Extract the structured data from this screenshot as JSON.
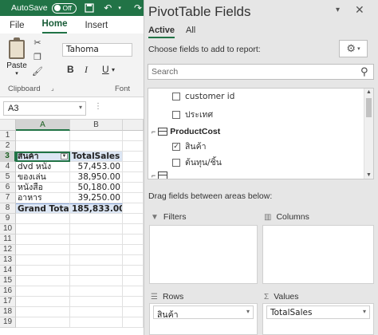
{
  "titlebar": {
    "autosave_label": "AutoSave",
    "autosave_state": "Off"
  },
  "ribbon": {
    "tabs": [
      "File",
      "Home",
      "Insert"
    ],
    "paste_label": "Paste",
    "font_name": "Tahoma",
    "bold": "B",
    "italic": "I",
    "underline": "U",
    "group_clipboard": "Clipboard",
    "group_font": "Font"
  },
  "formula": {
    "name_box": "A3"
  },
  "grid": {
    "columns": [
      "A",
      "B"
    ],
    "rows": [
      {
        "n": "1",
        "a": "",
        "b": ""
      },
      {
        "n": "2",
        "a": "",
        "b": ""
      },
      {
        "n": "3",
        "a": "สินค้า",
        "b": "TotalSales"
      },
      {
        "n": "4",
        "a": "dvd หนัง",
        "b": "57,453.00"
      },
      {
        "n": "5",
        "a": "ของเล่น",
        "b": "38,950.00"
      },
      {
        "n": "6",
        "a": "หนังสือ",
        "b": "50,180.00"
      },
      {
        "n": "7",
        "a": "อาหาร",
        "b": "39,250.00"
      },
      {
        "n": "8",
        "a": "Grand Total",
        "b": "185,833.00"
      },
      {
        "n": "9",
        "a": "",
        "b": ""
      },
      {
        "n": "10",
        "a": "",
        "b": ""
      },
      {
        "n": "11",
        "a": "",
        "b": ""
      },
      {
        "n": "12",
        "a": "",
        "b": ""
      },
      {
        "n": "13",
        "a": "",
        "b": ""
      },
      {
        "n": "14",
        "a": "",
        "b": ""
      },
      {
        "n": "15",
        "a": "",
        "b": ""
      },
      {
        "n": "16",
        "a": "",
        "b": ""
      },
      {
        "n": "17",
        "a": "",
        "b": ""
      },
      {
        "n": "18",
        "a": "",
        "b": ""
      },
      {
        "n": "19",
        "a": "",
        "b": ""
      }
    ]
  },
  "pane": {
    "title": "PivotTable Fields",
    "tabs": [
      "Active",
      "All"
    ],
    "choose_label": "Choose fields to add to report:",
    "search_placeholder": "Search",
    "fields": [
      {
        "label": "customer id",
        "checked": false
      },
      {
        "label": "ประเทศ",
        "checked": false
      }
    ],
    "table_name": "ProductCost",
    "table_fields": [
      {
        "label": "สินค้า",
        "checked": true
      },
      {
        "label": "ต้นทุน/ชิ้น",
        "checked": false
      }
    ],
    "drag_label": "Drag fields between areas below:",
    "areas": {
      "filters": "Filters",
      "columns": "Columns",
      "rows": "Rows",
      "values": "Values"
    },
    "rows_field": "สินค้า",
    "values_field": "TotalSales"
  }
}
